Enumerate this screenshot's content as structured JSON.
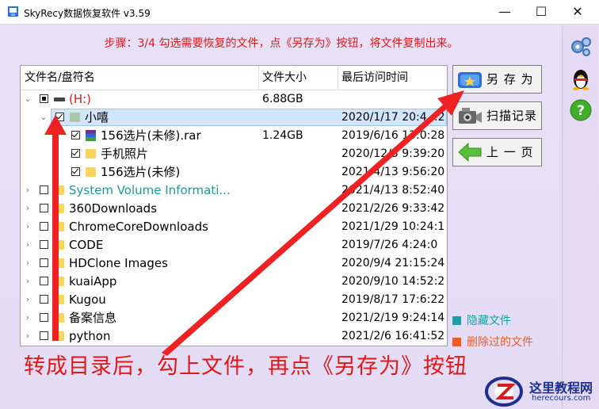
{
  "window": {
    "title": "SkyRecy数据恢复软件 v3.59",
    "minimize": "—",
    "maximize": "☐",
    "close": "✕"
  },
  "step_text": "步骤：3/4 勾选需要恢复的文件，点《另存为》按钮，将文件复制出来。",
  "columns": {
    "name": "文件名/盘符名",
    "size": "文件大小",
    "time": "最后访问时间"
  },
  "rows": [
    {
      "level": 0,
      "expander": "⌄",
      "check": "part",
      "icon": "drive",
      "name": "(H:)",
      "style": "red",
      "size": "6.88GB",
      "time": ""
    },
    {
      "level": 1,
      "expander": "⌄",
      "check": "checked",
      "icon": "folder-gray",
      "name": "小嘻",
      "style": "normal",
      "size": "",
      "time": "2020/1/17 20:4…2",
      "selected": true
    },
    {
      "level": 2,
      "expander": "",
      "check": "checked",
      "icon": "rar",
      "name": "156选片(未修).rar",
      "style": "normal",
      "size": "1.24GB",
      "time": "2019/6/16 13:0:28"
    },
    {
      "level": 2,
      "expander": "",
      "check": "checked",
      "icon": "folder",
      "name": "手机照片",
      "style": "normal",
      "size": "",
      "time": "2020/12/3 9:39:20"
    },
    {
      "level": 2,
      "expander": "",
      "check": "checked",
      "icon": "folder",
      "name": "156选片(未修)",
      "style": "normal",
      "size": "",
      "time": "2021/4/13 9:56:20"
    },
    {
      "level": 0,
      "expander": "›",
      "check": "empty",
      "icon": "folder",
      "name": "System Volume Informati...",
      "style": "sys",
      "size": "",
      "time": "2021/4/13 8:52:40"
    },
    {
      "level": 0,
      "expander": "›",
      "check": "empty",
      "icon": "folder",
      "name": "360Downloads",
      "style": "normal",
      "size": "",
      "time": "2021/2/26 9:33:42"
    },
    {
      "level": 0,
      "expander": "›",
      "check": "empty",
      "icon": "folder",
      "name": "ChromeCoreDownloads",
      "style": "normal",
      "size": "",
      "time": "2021/1/29 10:24:1"
    },
    {
      "level": 0,
      "expander": "›",
      "check": "empty",
      "icon": "folder",
      "name": "CODE",
      "style": "normal",
      "size": "",
      "time": "2019/7/26 4:24:0"
    },
    {
      "level": 0,
      "expander": "›",
      "check": "empty",
      "icon": "folder",
      "name": "HDClone Images",
      "style": "normal",
      "size": "",
      "time": "2020/9/4 21:15:24"
    },
    {
      "level": 0,
      "expander": "›",
      "check": "empty",
      "icon": "folder",
      "name": "kuaiApp",
      "style": "normal",
      "size": "",
      "time": "2020/9/10 14:52:2"
    },
    {
      "level": 0,
      "expander": "›",
      "check": "empty",
      "icon": "folder",
      "name": "Kugou",
      "style": "normal",
      "size": "",
      "time": "2019/8/17 17:6:22"
    },
    {
      "level": 0,
      "expander": "›",
      "check": "empty",
      "icon": "folder",
      "name": "备案信息",
      "style": "normal",
      "size": "",
      "time": "2021/2/19 9:24:14"
    },
    {
      "level": 0,
      "expander": "›",
      "check": "empty",
      "icon": "folder",
      "name": "python",
      "style": "normal",
      "size": "",
      "time": "2021/2/6 16:41:52"
    }
  ],
  "buttons": {
    "save_as": "另 存 为",
    "scan_log": "扫描记录",
    "prev_page": "上 一 页"
  },
  "legend": {
    "hidden": "隐藏文件",
    "deleted": "删除过的文件",
    "hidden_color": "#17a0a5",
    "deleted_color": "#f05a23"
  },
  "annotation": "转成目录后，勾上文件，再点《另存为》按钮",
  "watermark": {
    "name": "这里教程网",
    "url": "herecours.com"
  }
}
